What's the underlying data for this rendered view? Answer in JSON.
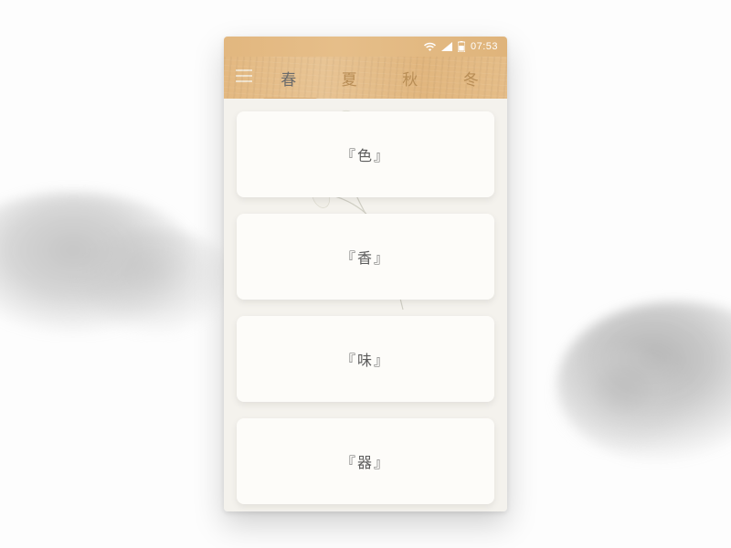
{
  "statusbar": {
    "time": "07:53"
  },
  "tabs": {
    "items": [
      {
        "label": "春",
        "active": true
      },
      {
        "label": "夏",
        "active": false
      },
      {
        "label": "秋",
        "active": false
      },
      {
        "label": "冬",
        "active": false
      }
    ]
  },
  "cards": [
    {
      "label": "『色』"
    },
    {
      "label": "『香』"
    },
    {
      "label": "『味』"
    },
    {
      "label": "『器』"
    }
  ],
  "colors": {
    "header": "#e3b880",
    "indicator": "#d9aa70",
    "card_bg": "#fdfcf9",
    "page_bg": "#f4f2ed",
    "text": "#5c5c5c"
  }
}
